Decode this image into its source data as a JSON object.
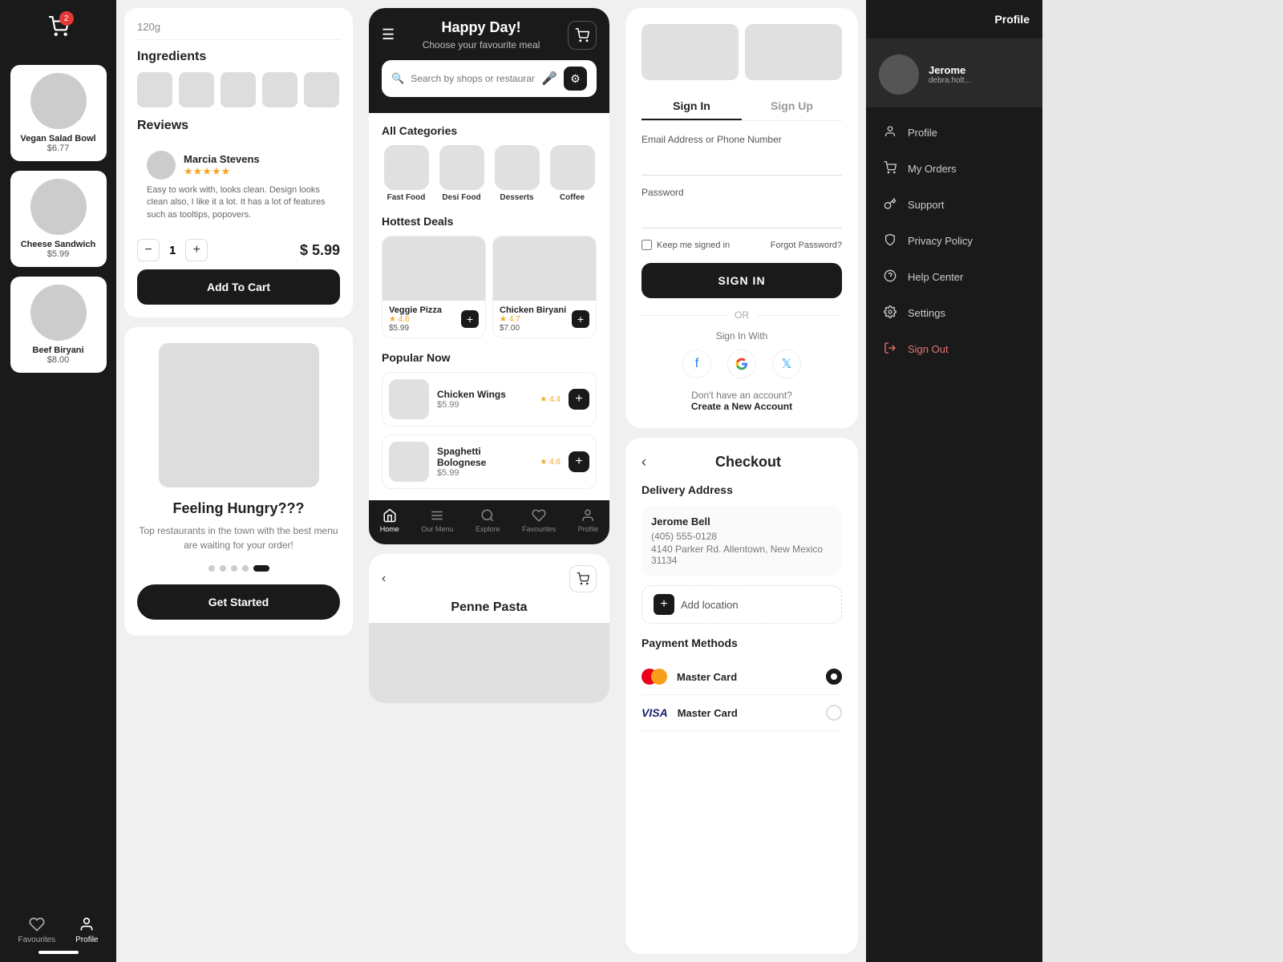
{
  "col1": {
    "cart_badge": "2",
    "food_items": [
      {
        "name": "Vegan Salad Bowl",
        "price": "$6.77"
      },
      {
        "name": "Cheese Sandwich",
        "price": "$5.99"
      },
      {
        "name": "Beef Biryani",
        "price": "$8.00"
      }
    ],
    "nav": {
      "items": [
        {
          "label": "Favourites",
          "icon": "heart"
        },
        {
          "label": "Profile",
          "icon": "user"
        }
      ]
    }
  },
  "col2": {
    "product_detail": {
      "ingredients_title": "Ingredients",
      "reviews_title": "Reviews",
      "reviewer_name": "Marcia Stevens",
      "review_text": "Easy to work with, looks clean. Design looks clean also, I like it a lot. It has a lot of features such as tooltips, popovers.",
      "qty": "1",
      "price": "$ 5.99",
      "add_to_cart_label": "Add To Cart"
    },
    "onboarding": {
      "title": "Feeling Hungry???",
      "description": "Top restaurants in the town with the best menu are waiting for your order!",
      "get_started_label": "Get Started"
    }
  },
  "col3": {
    "app": {
      "greeting": "Happy Day!",
      "subtitle": "Choose your favourite meal",
      "search_placeholder": "Search by shops or restaurants...",
      "categories_title": "All Categories",
      "categories": [
        {
          "label": "Fast Food"
        },
        {
          "label": "Desi Food"
        },
        {
          "label": "Desserts"
        },
        {
          "label": "Coffee"
        }
      ],
      "deals_title": "Hottest Deals",
      "deals": [
        {
          "name": "Veggie Pizza",
          "price": "$5.99",
          "rating": "4.6"
        },
        {
          "name": "Chicken Biryani",
          "price": "$7.00",
          "rating": "4.7"
        }
      ],
      "popular_title": "Popular Now",
      "popular": [
        {
          "name": "Chicken Wings",
          "price": "$5.99",
          "rating": "4.4"
        },
        {
          "name": "Spaghetti Bolognese",
          "price": "$5.99",
          "rating": "4.6"
        }
      ],
      "nav_items": [
        {
          "label": "Home",
          "icon": "home"
        },
        {
          "label": "Our Menu",
          "icon": "menu"
        },
        {
          "label": "Explore",
          "icon": "search"
        },
        {
          "label": "Favourites",
          "icon": "heart"
        },
        {
          "label": "Profile",
          "icon": "user"
        }
      ]
    },
    "mini_app": {
      "dish_name": "Penne Pasta"
    }
  },
  "col4": {
    "auth": {
      "tab_signin": "Sign In",
      "tab_signup": "Sign Up",
      "email_label": "Email Address or Phone Number",
      "password_label": "Password",
      "keep_signed_label": "Keep me signed in",
      "forgot_pw_label": "Forgot Password?",
      "sign_in_btn": "SIGN IN",
      "or_text": "OR",
      "sign_in_with": "Sign In With",
      "no_account": "Don't have an account?",
      "create_account": "Create a New Account"
    },
    "checkout": {
      "title": "Checkout",
      "delivery_title": "Delivery Address",
      "customer_name": "Jerome Bell",
      "phone": "(405) 555-0128",
      "address": "4140 Parker Rd. Allentown, New Mexico 31134",
      "add_location_label": "Add location",
      "payment_title": "Payment Methods",
      "payment_methods": [
        {
          "type": "mastercard",
          "name": "Master Card",
          "selected": true
        },
        {
          "type": "visa_mc",
          "name": "Master Card",
          "selected": false
        }
      ]
    }
  },
  "col5": {
    "profile_name": "Jerome",
    "profile_email": "debra.holt...",
    "profile_tab_label": "Profile",
    "menu_items": [
      {
        "label": "Profile",
        "icon": "user"
      },
      {
        "label": "My Orders",
        "icon": "cart"
      },
      {
        "label": "Support",
        "icon": "key"
      },
      {
        "label": "Privacy Policy",
        "icon": "shield"
      },
      {
        "label": "Help Center",
        "icon": "help"
      },
      {
        "label": "Settings",
        "icon": "settings"
      },
      {
        "label": "Sign Out",
        "icon": "signout"
      }
    ]
  }
}
